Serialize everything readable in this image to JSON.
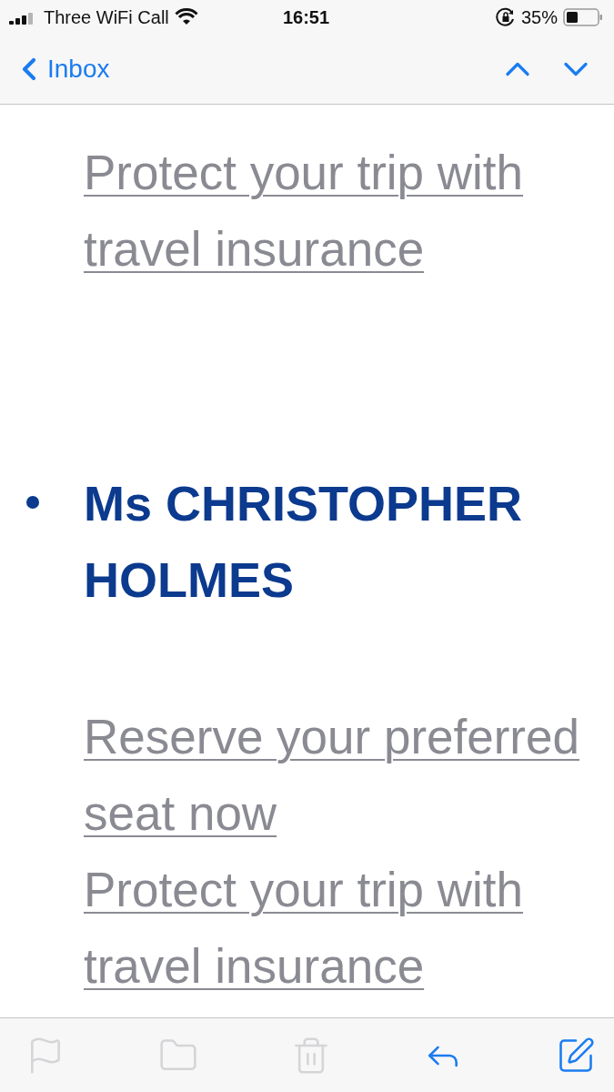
{
  "status_bar": {
    "carrier": "Three WiFi Call",
    "time": "16:51",
    "battery": "35%"
  },
  "nav": {
    "back": "Inbox"
  },
  "email": {
    "blocks": [
      {
        "kind": "links",
        "links": [
          "Protect your trip with travel insurance"
        ]
      },
      {
        "kind": "bullet",
        "text": "Ms CHRISTOPHER HOLMES"
      },
      {
        "kind": "links",
        "links": [
          "Reserve your preferred seat now",
          "Protect your trip with travel insurance"
        ]
      }
    ]
  },
  "toolbar": [
    {
      "kind": "flag",
      "disabled": true
    },
    {
      "kind": "folder",
      "disabled": true
    },
    {
      "kind": "trash",
      "disabled": true
    },
    {
      "kind": "reply",
      "disabled": false
    },
    {
      "kind": "compose",
      "disabled": false
    }
  ]
}
